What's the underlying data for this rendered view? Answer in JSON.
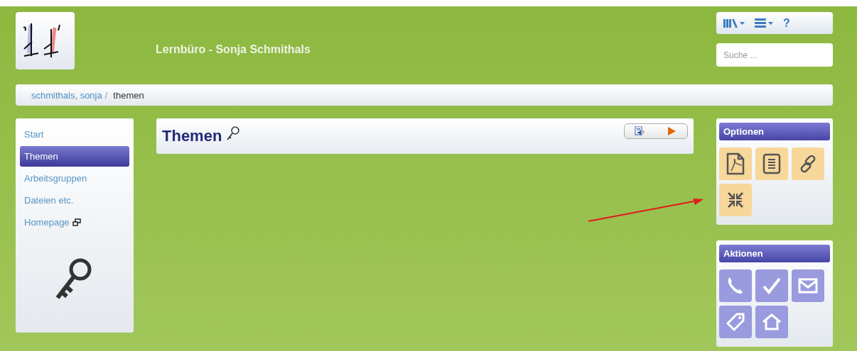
{
  "header": {
    "title": "Lernbüro - Sonja Schmithals",
    "help": "?",
    "search": {
      "placeholder": "Suche ..."
    }
  },
  "breadcrumb_separator": "/",
  "breadcrumb": [
    {
      "label": "schmithals, sonja",
      "current": false
    },
    {
      "label": "themen",
      "current": true
    }
  ],
  "sidebar": {
    "items": [
      {
        "label": "Start",
        "selected": false,
        "kind": "link"
      },
      {
        "label": "Themen",
        "selected": true,
        "kind": "link"
      },
      {
        "label": "Arbeitsgruppen",
        "selected": false,
        "kind": "link"
      },
      {
        "label": "Dateien etc.",
        "selected": false,
        "kind": "link"
      },
      {
        "label": "Homepage",
        "selected": false,
        "kind": "external"
      }
    ]
  },
  "content": {
    "title": "Themen"
  },
  "panels": [
    {
      "title": "Optionen",
      "kind": "options",
      "buttons": [
        {
          "kind": "pdf"
        },
        {
          "kind": "text"
        },
        {
          "kind": "link"
        },
        {
          "kind": "collapse"
        }
      ]
    },
    {
      "title": "Aktionen",
      "kind": "actions",
      "buttons": [
        {
          "kind": "phone"
        },
        {
          "kind": "check"
        },
        {
          "kind": "mail"
        },
        {
          "kind": "tag"
        },
        {
          "kind": "home"
        }
      ]
    }
  ]
}
